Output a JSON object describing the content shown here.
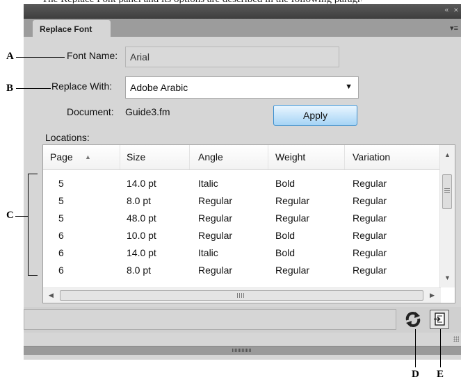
{
  "window": {
    "tab_title": "Replace Font",
    "collapse_glyph": "«",
    "close_glyph": "×",
    "panel_menu_glyph": "▾≡"
  },
  "form": {
    "font_name_label": "Font Name:",
    "font_name_value": "Arial",
    "replace_with_label": "Replace With:",
    "replace_with_value": "Adobe Arabic",
    "document_label": "Document:",
    "document_value": "Guide3.fm",
    "apply_label": "Apply"
  },
  "locations": {
    "label": "Locations:",
    "columns": [
      "Page",
      "Size",
      "Angle",
      "Weight",
      "Variation"
    ],
    "sort_column": "Page",
    "sort_direction": "ascending",
    "rows": [
      [
        "5",
        "14.0 pt",
        "Italic",
        "Bold",
        "Regular"
      ],
      [
        "5",
        "8.0 pt",
        "Regular",
        "Regular",
        "Regular"
      ],
      [
        "5",
        "48.0 pt",
        "Regular",
        "Regular",
        "Regular"
      ],
      [
        "6",
        "10.0 pt",
        "Regular",
        "Bold",
        "Regular"
      ],
      [
        "6",
        "14.0 pt",
        "Italic",
        "Bold",
        "Regular"
      ],
      [
        "6",
        "8.0 pt",
        "Regular",
        "Regular",
        "Regular"
      ]
    ]
  },
  "toolbar": {
    "refresh_icon": "refresh-icon",
    "goto_icon": "go-to-location-icon"
  },
  "callouts": [
    "A",
    "B",
    "C",
    "D",
    "E"
  ],
  "colors": {
    "panel_bg": "#d6d6d6",
    "titlebar_bg": "#4a4a4a",
    "tabstrip_bg": "#9c9c9c",
    "apply_accent": "#3a8fd0"
  }
}
